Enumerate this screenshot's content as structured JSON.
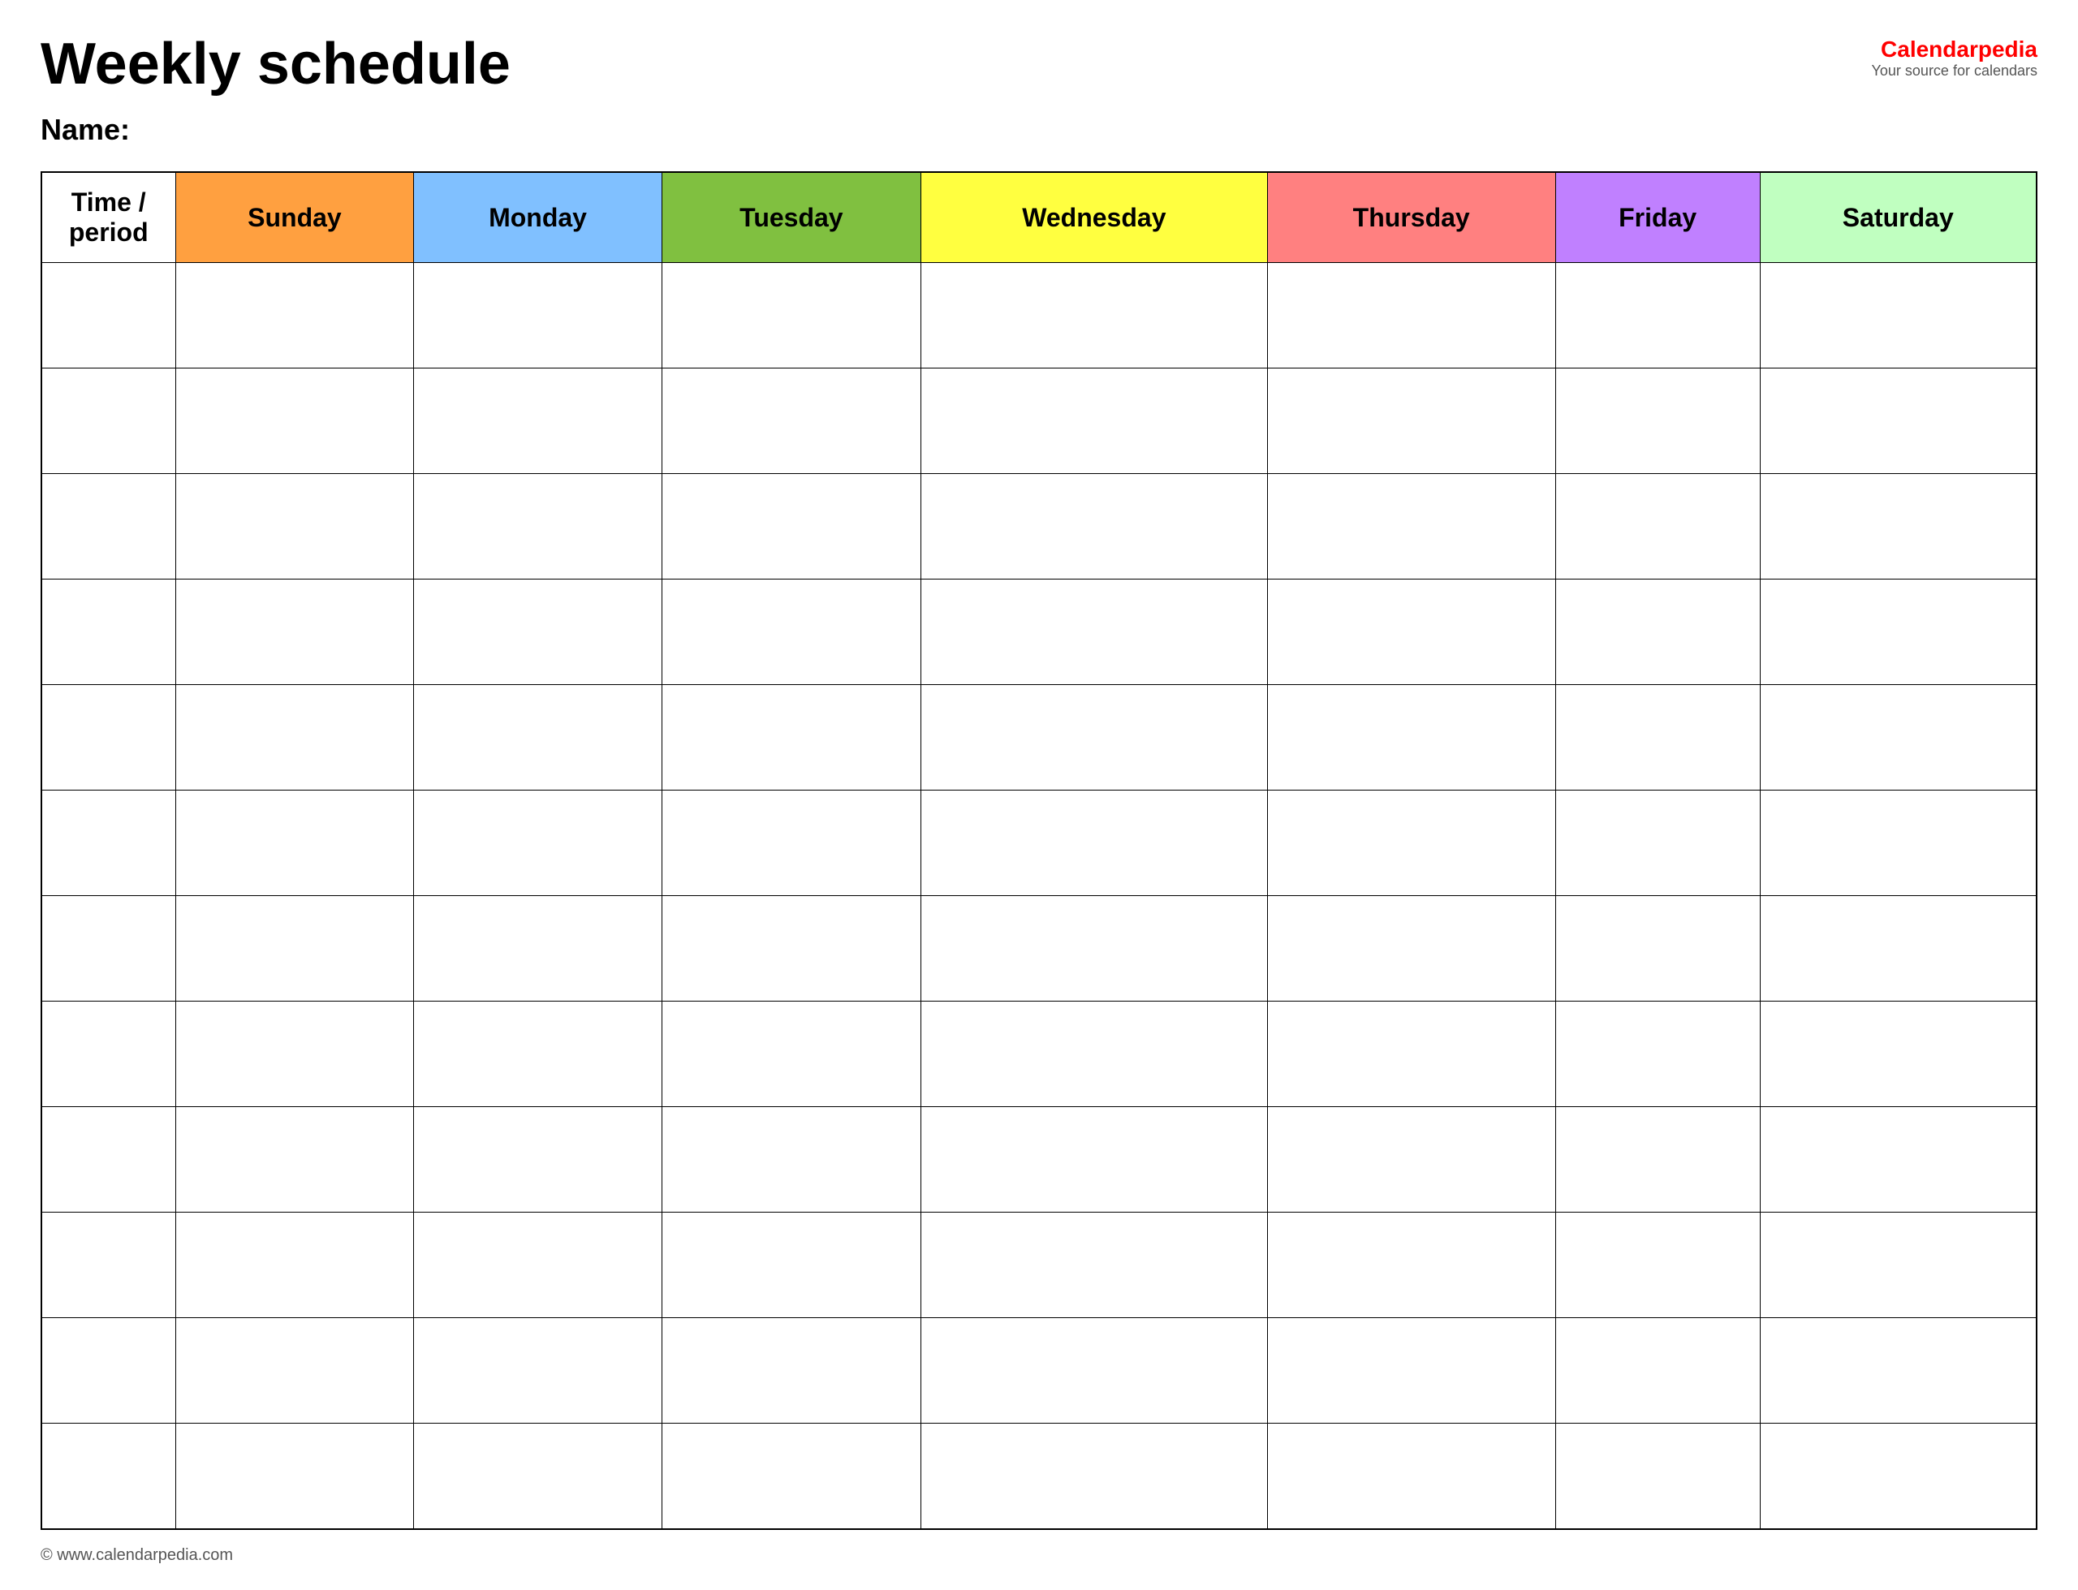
{
  "page": {
    "title": "Weekly schedule",
    "name_label": "Name:",
    "logo_main": "Calendar",
    "logo_highlight": "pedia",
    "logo_subtitle": "Your source for calendars",
    "footer_text": "© www.calendarpedia.com"
  },
  "table": {
    "headers": [
      {
        "id": "time-period",
        "label": "Time / period",
        "color": "#ffffff",
        "class": "time-period-header"
      },
      {
        "id": "sunday",
        "label": "Sunday",
        "color": "#ffa040",
        "class": "sunday-header"
      },
      {
        "id": "monday",
        "label": "Monday",
        "color": "#80c0ff",
        "class": "monday-header"
      },
      {
        "id": "tuesday",
        "label": "Tuesday",
        "color": "#80c040",
        "class": "tuesday-header"
      },
      {
        "id": "wednesday",
        "label": "Wednesday",
        "color": "#ffff40",
        "class": "wednesday-header"
      },
      {
        "id": "thursday",
        "label": "Thursday",
        "color": "#ff8080",
        "class": "thursday-header"
      },
      {
        "id": "friday",
        "label": "Friday",
        "color": "#c080ff",
        "class": "friday-header"
      },
      {
        "id": "saturday",
        "label": "Saturday",
        "color": "#c0ffc0",
        "class": "saturday-header"
      }
    ],
    "row_count": 12
  }
}
